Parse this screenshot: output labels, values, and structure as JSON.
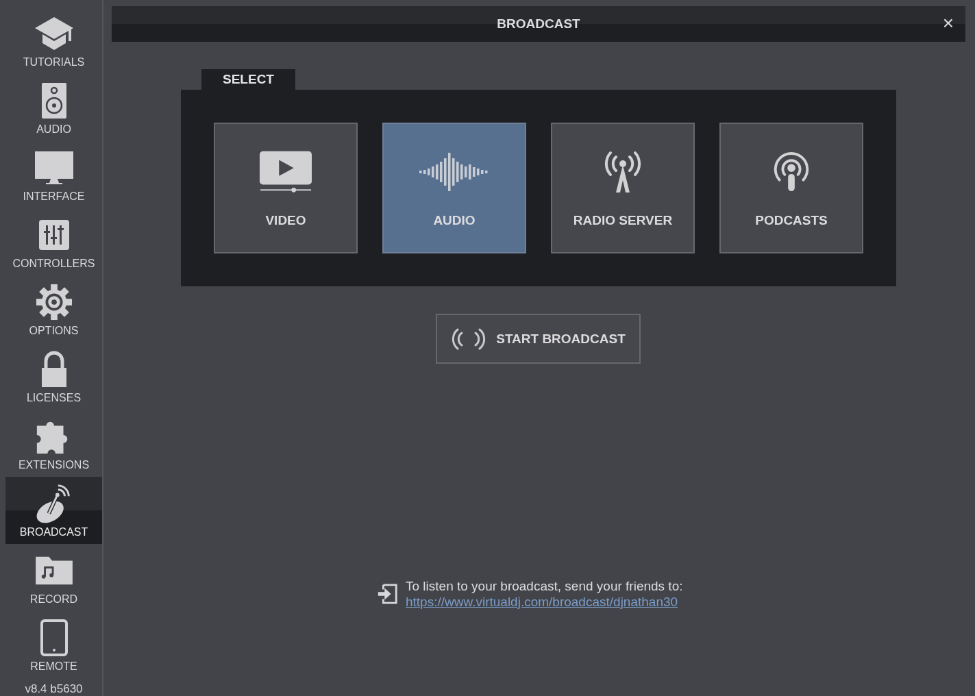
{
  "sidebar": {
    "items": [
      {
        "label": "TUTORIALS",
        "selected": false
      },
      {
        "label": "AUDIO",
        "selected": false
      },
      {
        "label": "INTERFACE",
        "selected": false
      },
      {
        "label": "CONTROLLERS",
        "selected": false
      },
      {
        "label": "OPTIONS",
        "selected": false
      },
      {
        "label": "LICENSES",
        "selected": false
      },
      {
        "label": "EXTENSIONS",
        "selected": false
      },
      {
        "label": "BROADCAST",
        "selected": true
      },
      {
        "label": "RECORD",
        "selected": false
      },
      {
        "label": "REMOTE",
        "selected": false
      }
    ],
    "version": "v8.4 b5630"
  },
  "dialog": {
    "title": "BROADCAST",
    "close": "×"
  },
  "select": {
    "tab": "SELECT",
    "options": [
      {
        "label": "VIDEO",
        "selected": false
      },
      {
        "label": "AUDIO",
        "selected": true
      },
      {
        "label": "RADIO SERVER",
        "selected": false
      },
      {
        "label": "PODCASTS",
        "selected": false
      }
    ]
  },
  "start_button": "START BROADCAST",
  "footer": {
    "text": "To listen to your broadcast, send your friends to:",
    "link": "https://www.virtualdj.com/broadcast/djnathan30"
  }
}
